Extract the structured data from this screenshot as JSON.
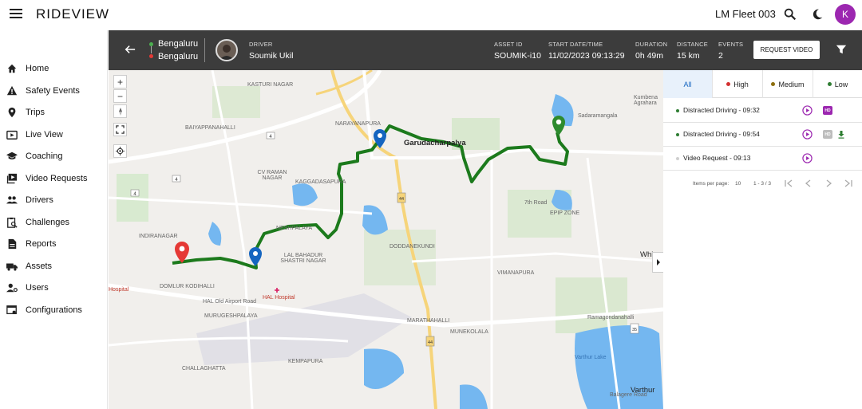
{
  "app": {
    "logo": "RIDEVIEW",
    "fleet_name": "LM Fleet 003",
    "avatar_initial": "K"
  },
  "colors": {
    "accent": "#9c27b0",
    "route": "#1c7a1c",
    "high": "#d32f2f",
    "medium": "#8d6e0e",
    "low": "#2e7d32",
    "header_bg": "#3c3c3c"
  },
  "sidebar": {
    "items": [
      {
        "label": "Home",
        "icon": "home-icon"
      },
      {
        "label": "Safety Events",
        "icon": "warning-icon"
      },
      {
        "label": "Trips",
        "icon": "location-pin-icon"
      },
      {
        "label": "Live View",
        "icon": "live-view-icon"
      },
      {
        "label": "Coaching",
        "icon": "graduation-cap-icon"
      },
      {
        "label": "Video Requests",
        "icon": "video-library-icon"
      },
      {
        "label": "Drivers",
        "icon": "people-icon"
      },
      {
        "label": "Challenges",
        "icon": "clipboard-search-icon"
      },
      {
        "label": "Reports",
        "icon": "document-icon"
      },
      {
        "label": "Assets",
        "icon": "truck-icon"
      },
      {
        "label": "Users",
        "icon": "user-settings-icon"
      },
      {
        "label": "Configurations",
        "icon": "settings-window-icon"
      }
    ]
  },
  "trip": {
    "from": "Bengaluru",
    "to": "Bengaluru",
    "driver_label": "DRIVER",
    "driver_name": "Soumik Ukil",
    "asset_label": "ASSET ID",
    "asset_id": "SOUMIK-i10",
    "start_label": "START DATE/TIME",
    "start": "11/02/2023 09:13:29",
    "duration_label": "DURATION",
    "duration": "0h 49m",
    "distance_label": "DISTANCE",
    "distance": "15 km",
    "events_label": "EVENTS",
    "events": "2",
    "request_video": "REQUEST VIDEO"
  },
  "map": {
    "labels": [
      "KASTURI NAGAR",
      "BAIYAPPANAHALLI",
      "CV RAMAN NAGAR",
      "KAGGADASAPURA",
      "NARAYANAPURA",
      "Garudacharpalya",
      "Kumbena Agrahara",
      "Sadaramangala",
      "7th Road",
      "EPIP ZONE",
      "INDIRANAGAR",
      "LAL BAHADUR SHASTRI NAGAR",
      "DODDANEKUNDI",
      "VIMANAPURA",
      "HAL Hospital",
      "DOMLUR KODIHALLI",
      "HAL Old Airport Road",
      "MURUGESHPALAYA",
      "MARATHAHALLI",
      "Ramagondanahalli",
      "MUNEKOLALA",
      "KEMPAPURA",
      "CHALLAGHATTA",
      "Varthur Lake",
      "Varthur",
      "Balagere Road",
      "Whi",
      "Hospital",
      "NESHPALAYA"
    ],
    "road_shields": [
      "4",
      "4",
      "4",
      "44",
      "44",
      "35"
    ],
    "controls": {
      "zoom_in": "+",
      "zoom_out": "−"
    }
  },
  "panel": {
    "tabs": [
      {
        "label": "All",
        "color": ""
      },
      {
        "label": "High",
        "color": "#d32f2f"
      },
      {
        "label": "Medium",
        "color": "#8d6e0e"
      },
      {
        "label": "Low",
        "color": "#2e7d32"
      }
    ],
    "events": [
      {
        "label": "Distracted Driving - 09:32",
        "dot": "#2e7d32",
        "hd": "HD",
        "hd_color": "#9c27b0",
        "download": false
      },
      {
        "label": "Distracted Driving - 09:54",
        "dot": "#2e7d32",
        "hd": "HD",
        "hd_color": "#bdbdbd",
        "download": true
      },
      {
        "label": "Video Request - 09:13",
        "dot": "#cfcfcf",
        "hd": "",
        "hd_color": "",
        "download": false
      }
    ],
    "pager": {
      "items_label": "Items per page:",
      "items_value": "10",
      "range": "1 - 3 / 3"
    }
  }
}
